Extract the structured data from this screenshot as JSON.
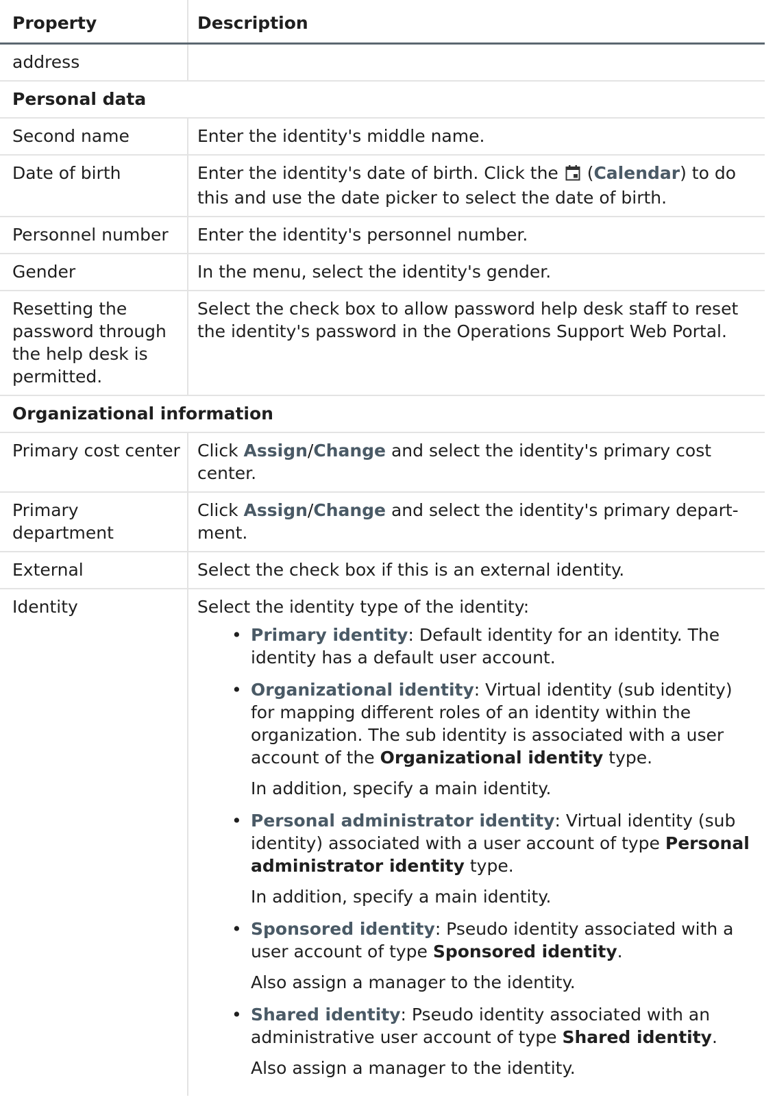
{
  "header": {
    "property": "Property",
    "description": "Description"
  },
  "address_row": {
    "property": "address",
    "description": ""
  },
  "section_personal": "Personal data",
  "personal_rows": [
    {
      "property": "Second name",
      "description": "Enter the identity's middle name."
    },
    {
      "property": "Date of birth",
      "desc_pre": "Enter the identity's date of birth. Click the ",
      "desc_open": " (",
      "desc_bold": "Calendar",
      "desc_post": ") to do this and use the date picker to select the date of birth.",
      "icon": "calendar-icon"
    },
    {
      "property": "Personnel number",
      "description": "Enter the identity's personnel number."
    },
    {
      "property": "Gender",
      "description": "In the menu, select the identity's gender."
    },
    {
      "property": "Resetting the password through the help desk is permitted.",
      "description": "Select the check box to allow password help desk staff to reset the identity's password in the Operations Support Web Portal."
    }
  ],
  "section_org": "Organizational information",
  "org_rows": [
    {
      "property": "Primary cost center",
      "desc_pre": "Click ",
      "bold1": "Assign",
      "slash": "/",
      "bold2": "Change",
      "desc_post": " and select the identity's primary cost center."
    },
    {
      "property": "Primary department",
      "desc_pre": "Click ",
      "bold1": "Assign",
      "slash": "/",
      "bold2": "Change",
      "desc_post": " and select the identity's primary depart-ment."
    },
    {
      "property": "External",
      "description": "Select the check box if this is an external identity."
    }
  ],
  "identity_row": {
    "property": "Identity",
    "intro": "Select the identity type of the identity:",
    "bullet": "•",
    "types": [
      {
        "term": "Primary identity",
        "text": ": Default identity for an identity. The identity has a default user account.",
        "bold_tail": "",
        "tail": "",
        "note": ""
      },
      {
        "term": "Organizational identity",
        "text": ": Virtual identity (sub identity) for mapping different roles of an identity within the organization. The sub identity is associated with a user account of the ",
        "bold_tail": "Organizational identity",
        "tail": " type.",
        "note": "In addition, specify a main identity."
      },
      {
        "term": "Personal administrator identity",
        "text": ": Virtual identity (sub identity) associated with a user account of type ",
        "bold_tail": "Personal administrator identity",
        "tail": " type.",
        "note": "In addition, specify a main identity."
      },
      {
        "term": "Sponsored identity",
        "text": ": Pseudo identity associated with a user account of type ",
        "bold_tail": "Sponsored identity",
        "tail": ".",
        "note": "Also assign a manager to the identity."
      },
      {
        "term": "Shared identity",
        "text": ": Pseudo identity associated with an administrative user account of type ",
        "bold_tail": "Shared identity",
        "tail": ".",
        "note": "Also assign a manager to the identity."
      }
    ]
  }
}
